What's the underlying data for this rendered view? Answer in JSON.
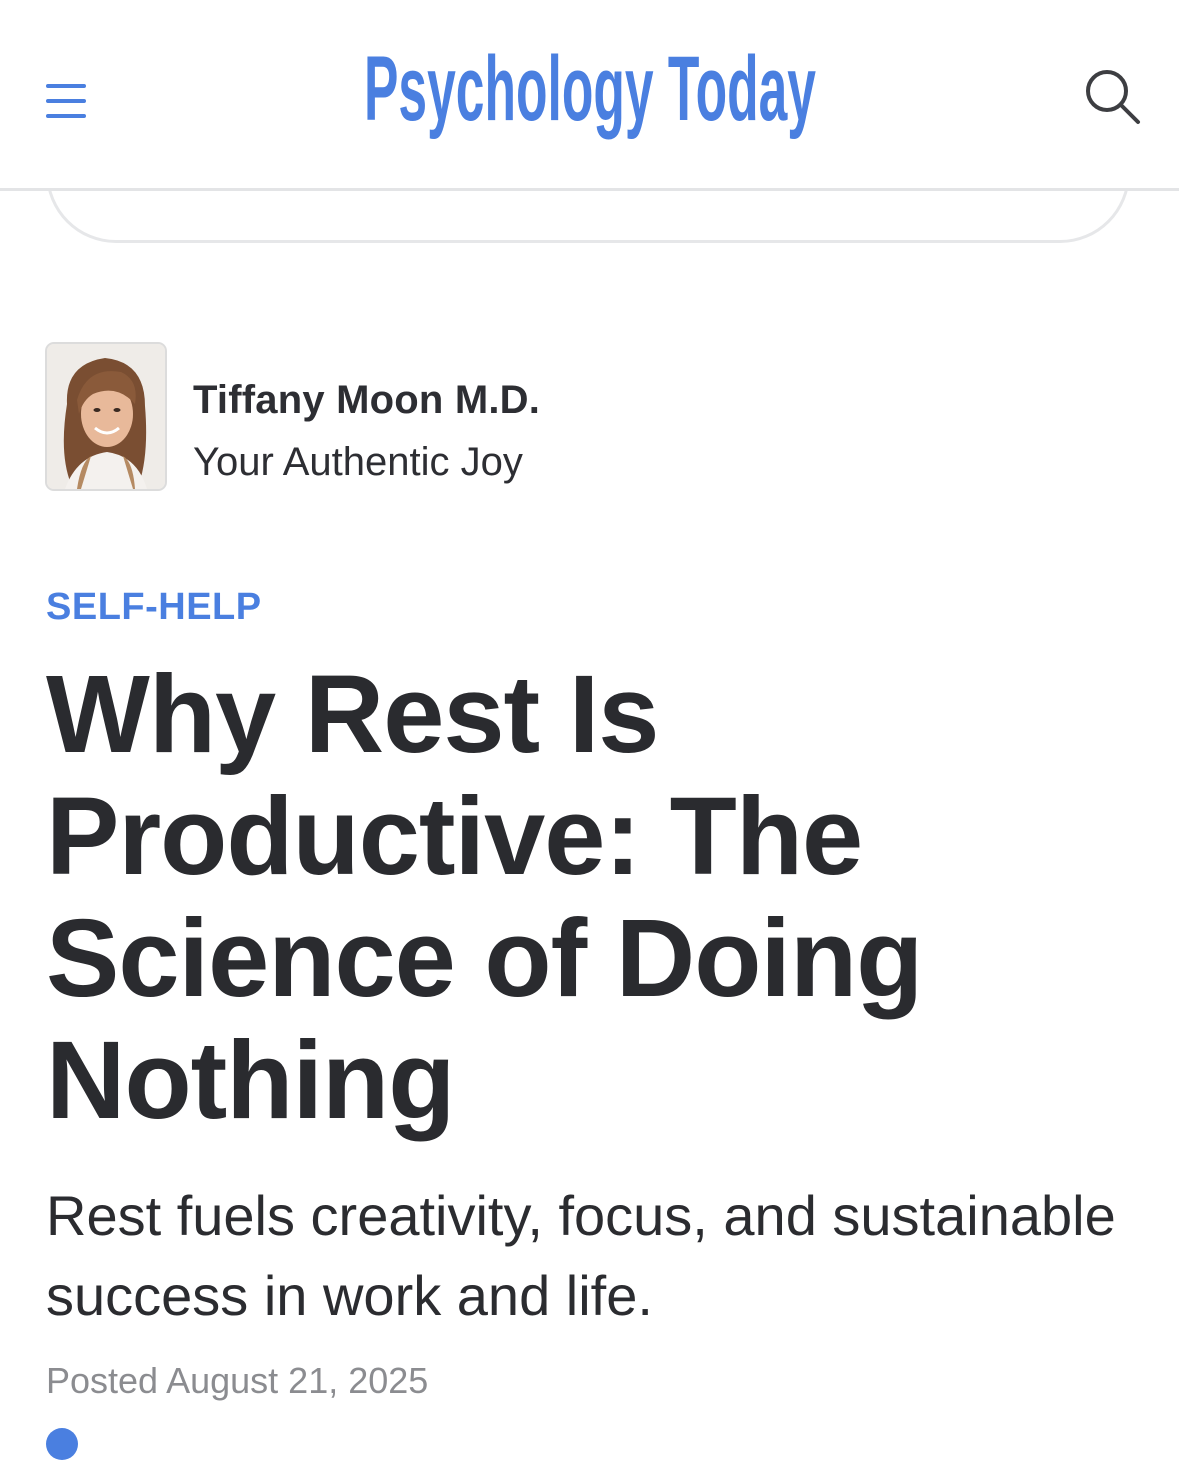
{
  "header": {
    "menu_icon": "hamburger-menu-icon",
    "logo_text": "Psychology Today",
    "search_icon": "search-icon"
  },
  "author": {
    "name": "Tiffany Moon M.D.",
    "blog": "Your Authentic Joy"
  },
  "article": {
    "category": "SELF-HELP",
    "title": "Why Rest Is Productive: The Science of Doing Nothing",
    "subtitle": "Rest fuels creativity, focus, and sustainable success in work and life.",
    "posted_label": "Posted",
    "posted_date": "August 21, 2025"
  },
  "colors": {
    "brand_blue": "#4a7fe0",
    "text_dark": "#2a2b2f",
    "text_muted": "#8b8c90"
  }
}
